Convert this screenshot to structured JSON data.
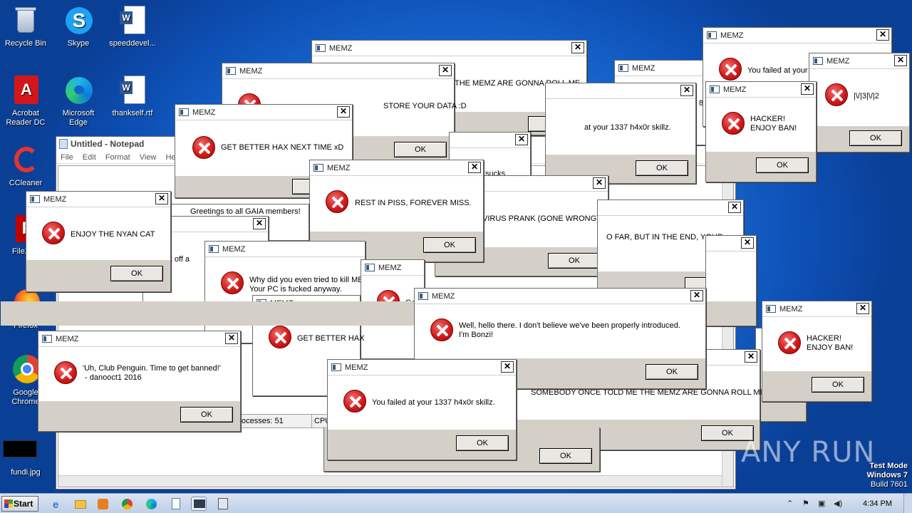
{
  "desktop": {
    "icons": [
      {
        "label": "Recycle Bin"
      },
      {
        "label": "Skype"
      },
      {
        "label": "speeddevel..."
      },
      {
        "label": "Acrobat Reader DC"
      },
      {
        "label": "Microsoft Edge"
      },
      {
        "label": "thankself.rtf"
      },
      {
        "label": "CCleaner"
      },
      {
        "label": "FileZilla"
      },
      {
        "label": "Firefox"
      },
      {
        "label": "Google Chrome"
      },
      {
        "label": "fundi.jpg"
      }
    ]
  },
  "notepad": {
    "title": "Untitled - Notepad",
    "menu": [
      "File",
      "Edit",
      "Format",
      "View",
      "Help"
    ]
  },
  "taskmgr": {
    "processes": "ocesses: 51",
    "cpu": "CPU"
  },
  "dialogs": [
    {
      "title": "MEMZ",
      "message": "THE MEMZ ARE GONNA ROLL ME",
      "ok": "OK"
    },
    {
      "title": "MEMZ",
      "message": "STORE YOUR DATA :D",
      "ok": "OK"
    },
    {
      "title": "MEMZ",
      "message": "GET BETTER HAX NEXT TIME xD",
      "ok": "OK"
    },
    {
      "title": "MEMZ",
      "message": "REST IN PISS, FOREVER MISS.",
      "ok": "OK"
    },
    {
      "title": "MEMZ",
      "message": "ENJOY THE NYAN CAT",
      "ok": "OK"
    },
    {
      "title": "MEMZ",
      "message": "Greetings to all GAIA members!",
      "ok": "OK"
    },
    {
      "title": "MEMZ",
      "message": "ng it off a",
      "ok": "OK"
    },
    {
      "title": "MEMZ",
      "message": "Why did you even tried to kill ME\nYour PC is fucked anyway.",
      "ok": "OK"
    },
    {
      "title": "MEMZ",
      "message": "GET BETTER HAX",
      "ok": "OK"
    },
    {
      "title": "MEMZ",
      "message": "Ge",
      "ok": "OK"
    },
    {
      "title": "MEMZ",
      "message": "'Uh, Club Penguin. Time to get banned!'\n - danooct1 2016",
      "ok": "OK"
    },
    {
      "title": "MEMZ",
      "message": "You failed at your 1337 h4x0r skillz.",
      "ok": "OK"
    },
    {
      "title": "MEMZ",
      "message": "Well, hello there. I don't believe we've been properly introduced.\nI'm Bonzi!",
      "ok": "OK"
    },
    {
      "title": "MEMZ",
      "message": "SOMEBODY ONCE TOLD ME THE MEMZ ARE GONNA ROLL ME",
      "ok": "OK"
    },
    {
      "title": "MEMZ",
      "message": "VIRUS PRANK (GONE WRONG)",
      "ok": "OK"
    },
    {
      "title": "MEMZ",
      "message": "O FAR, BUT IN THE END, YOUR",
      "ok": "OK"
    },
    {
      "title": "MEMZ",
      "message": "at your 1337 h4x0r skillz.",
      "ok": "OK"
    },
    {
      "title": "MEMZ",
      "message": "You failed at your",
      "ok": "OK"
    },
    {
      "title": "MEMZ",
      "message": "|\\/|3|\\/|2",
      "ok": "OK"
    },
    {
      "title": "MEMZ",
      "message": "HACKER!\nENJOY BAN!",
      "ok": "OK"
    },
    {
      "title": "MEMZ",
      "message": "HACKER!\nENJOY BAN!",
      "ok": "OK"
    },
    {
      "title": "MEMZ",
      "message": "sucks",
      "ok": "OK"
    },
    {
      "title": "MEMZ",
      "message": "8",
      "ok": "OK"
    }
  ],
  "watermark": {
    "line1": "Test Mode",
    "line2": "Windows 7",
    "line3": "Build 7601",
    "brand": "ANY RUN"
  },
  "taskbar": {
    "start_label": "Start",
    "clock": "4:34 PM"
  }
}
